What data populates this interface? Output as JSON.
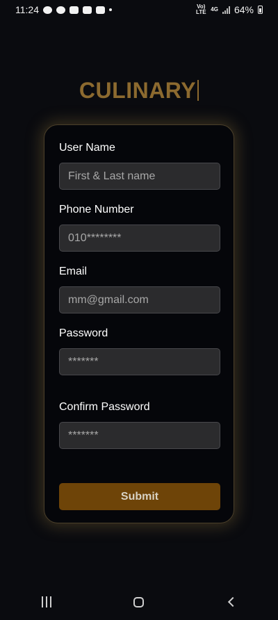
{
  "status_bar": {
    "time": "11:24",
    "notification_icons": [
      "chat-icon",
      "telegram-icon",
      "youtube-icon",
      "youtube-icon",
      "youtube-icon"
    ],
    "volte_label": "Vo) LTE",
    "network_label": "4G",
    "battery_percent": "64%"
  },
  "app": {
    "title": "CULINARY"
  },
  "form": {
    "fields": [
      {
        "label": "User Name",
        "placeholder": "First & Last name"
      },
      {
        "label": "Phone Number",
        "placeholder": "010********"
      },
      {
        "label": "Email",
        "placeholder": "mm@gmail.com"
      },
      {
        "label": "Password",
        "placeholder": "*******"
      },
      {
        "label": "Confirm Password",
        "placeholder": "*******"
      }
    ],
    "submit_label": "Submit"
  },
  "colors": {
    "accent": "#8c6a2f",
    "button": "#6e4408",
    "card_border": "#4a3f2a",
    "background": "#0a0b0f"
  }
}
